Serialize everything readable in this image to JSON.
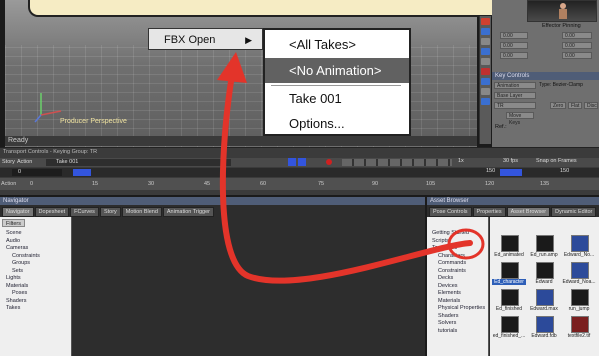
{
  "viewport": {
    "label": "Producer Perspective",
    "status": "Ready"
  },
  "context_menu": {
    "item": "FBX Open"
  },
  "submenu": {
    "items": [
      "<All Takes>",
      "<No Animation>",
      "Take 001",
      "Options..."
    ],
    "selected_index": 1
  },
  "right_panel": {
    "effector_title": "Effector Pinning",
    "key_controls_title": "Key Controls",
    "animation_label": "Animation",
    "type_label": "Type: Bezier-Clamp",
    "layer_value": "Base Layer",
    "trs_value": "TR",
    "zero_label": "Zero",
    "flat_label": "Flat",
    "disc_label": "Disc",
    "move_keys_label": "Move Keys",
    "ref_label": "Ref.:",
    "value_readouts": [
      "0.00",
      "0.00",
      "0.00",
      "0.00",
      "0.00",
      "0.00"
    ]
  },
  "transport": {
    "title": "Transport Controls - Keying Group: TR",
    "story_label": "Story",
    "action_label": "Action",
    "take_value": "Take 001",
    "fps": "30 fps",
    "snap_label": "Snap on Frames",
    "speed": "1x",
    "start_frame": "0",
    "end_frame": "150",
    "end_frame_right": "150",
    "action_row_label": "Action",
    "ruler_ticks": [
      "0",
      "15",
      "30",
      "45",
      "60",
      "75",
      "90",
      "105",
      "120",
      "135"
    ]
  },
  "navigator": {
    "title": "Navigator",
    "tabs": [
      "Navigator",
      "Dopesheet",
      "FCurves",
      "Story",
      "Motion Blend",
      "Animation Trigger"
    ],
    "filter_label": "Filters",
    "tree": [
      {
        "label": "Scene",
        "indent": 1
      },
      {
        "label": "Audio",
        "indent": 1
      },
      {
        "label": "Cameras",
        "indent": 1
      },
      {
        "label": "Constraints",
        "indent": 2
      },
      {
        "label": "Groups",
        "indent": 2
      },
      {
        "label": "Sets",
        "indent": 2
      },
      {
        "label": "Lights",
        "indent": 1
      },
      {
        "label": "Materials",
        "indent": 1
      },
      {
        "label": "Poses",
        "indent": 2
      },
      {
        "label": "Shaders",
        "indent": 1
      },
      {
        "label": "Takes",
        "indent": 1
      }
    ]
  },
  "asset_browser": {
    "title": "Asset Browser",
    "tabs": [
      "Pose Controls",
      "Properties",
      "Asset Browser",
      "Dynamic Editor"
    ],
    "tree": [
      {
        "label": "Getting Started",
        "indent": 1
      },
      {
        "label": "Scripts",
        "indent": 1
      },
      {
        "label": "Templates",
        "indent": 1
      },
      {
        "label": "Characters",
        "indent": 2
      },
      {
        "label": "Commands",
        "indent": 2
      },
      {
        "label": "Constraints",
        "indent": 2
      },
      {
        "label": "Decks",
        "indent": 2
      },
      {
        "label": "Devices",
        "indent": 2
      },
      {
        "label": "Elements",
        "indent": 2
      },
      {
        "label": "Materials",
        "indent": 2
      },
      {
        "label": "Physical Properties",
        "indent": 2
      },
      {
        "label": "Shaders",
        "indent": 2
      },
      {
        "label": "Solvers",
        "indent": 2
      },
      {
        "label": "tutorials",
        "indent": 2
      }
    ],
    "files": [
      "Ed_animated",
      "Ed_run.amp",
      "Edward_No...",
      "Ed_character",
      "Edward",
      "Edward_Noa...",
      "Ed_finished",
      "Edward.max",
      "run_jump",
      "ed_finished_...",
      "Edward.fdb",
      "textfile2.tif"
    ]
  },
  "annotation": {
    "arrow_color": "#e3342a",
    "callout_color": "#f6ecc4"
  }
}
